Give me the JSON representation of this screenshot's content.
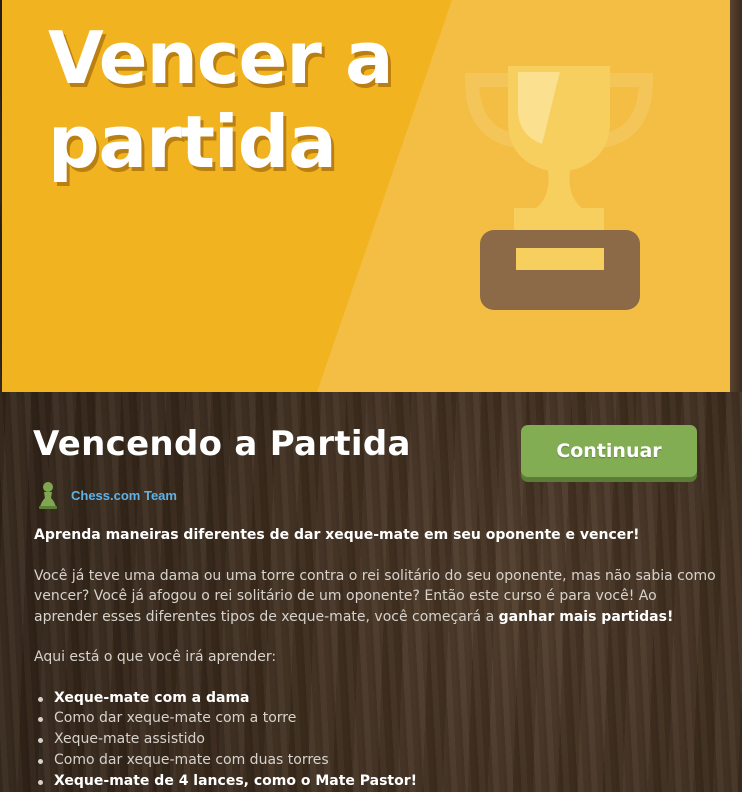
{
  "banner": {
    "title": "Vencer a\npartida"
  },
  "course": {
    "title": "Vencendo a Partida",
    "continue_label": "Continuar",
    "author": "Chess.com Team"
  },
  "description": {
    "lead": "Aprenda maneiras diferentes de dar xeque-mate em seu oponente e vencer!",
    "paragraph_start": "Você já teve uma dama ou uma torre contra o rei solitário do seu oponente, mas não sabia como vencer? Você já afogou o rei solitário de um oponente? Então este curso é para você! Ao aprender esses diferentes tipos de xeque-mate, você começará a ",
    "paragraph_bold": "ganhar mais partidas!",
    "intro": "Aqui está o que você irá aprender:",
    "items": [
      {
        "text": "Xeque-mate com a dama",
        "bold": true
      },
      {
        "text": "Como dar xeque-mate com a torre",
        "bold": false
      },
      {
        "text": "Xeque-mate assistido",
        "bold": false
      },
      {
        "text": "Como dar xeque-mate com duas torres",
        "bold": false
      },
      {
        "text": "Xeque-mate de 4 lances, como o Mate Pastor!",
        "bold": true
      }
    ]
  },
  "icons": {
    "banner_art": "trophy-icon",
    "author_avatar": "pawn-icon"
  },
  "colors": {
    "banner_left": "#f2b320",
    "banner_right": "#f4bd43",
    "continue_button": "#82ad52",
    "author_link": "#5fb2e5"
  }
}
